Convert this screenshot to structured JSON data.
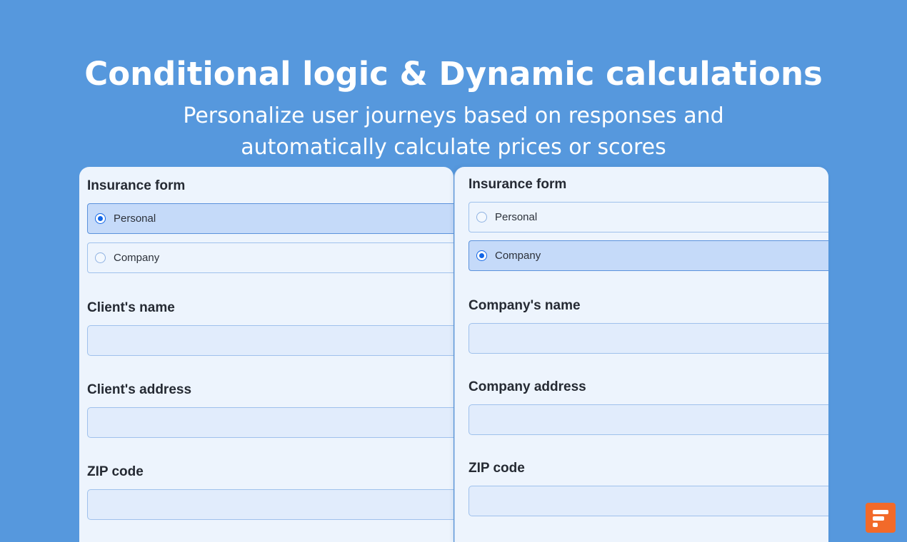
{
  "hero": {
    "title": "Conditional logic & Dynamic calculations",
    "subtitle_line1": "Personalize user journeys based on responses and",
    "subtitle_line2": "automatically calculate prices or scores"
  },
  "left_form": {
    "title": "Insurance form",
    "options": [
      {
        "label": "Personal",
        "selected": true
      },
      {
        "label": "Company",
        "selected": false
      }
    ],
    "fields": [
      {
        "label": "Client's name",
        "value": ""
      },
      {
        "label": "Client's address",
        "value": ""
      },
      {
        "label": "ZIP code",
        "value": ""
      }
    ]
  },
  "right_form": {
    "title": "Insurance form",
    "options": [
      {
        "label": "Personal",
        "selected": false
      },
      {
        "label": "Company",
        "selected": true
      }
    ],
    "fields": [
      {
        "label": "Company's name",
        "value": ""
      },
      {
        "label": "Company address",
        "value": ""
      },
      {
        "label": "ZIP code",
        "value": ""
      }
    ]
  },
  "brand": {
    "logo_icon": "formaloo-logo-icon",
    "accent_color": "#f26a2a",
    "background_color": "#5698dd",
    "selected_radio_color": "#1266e6"
  }
}
